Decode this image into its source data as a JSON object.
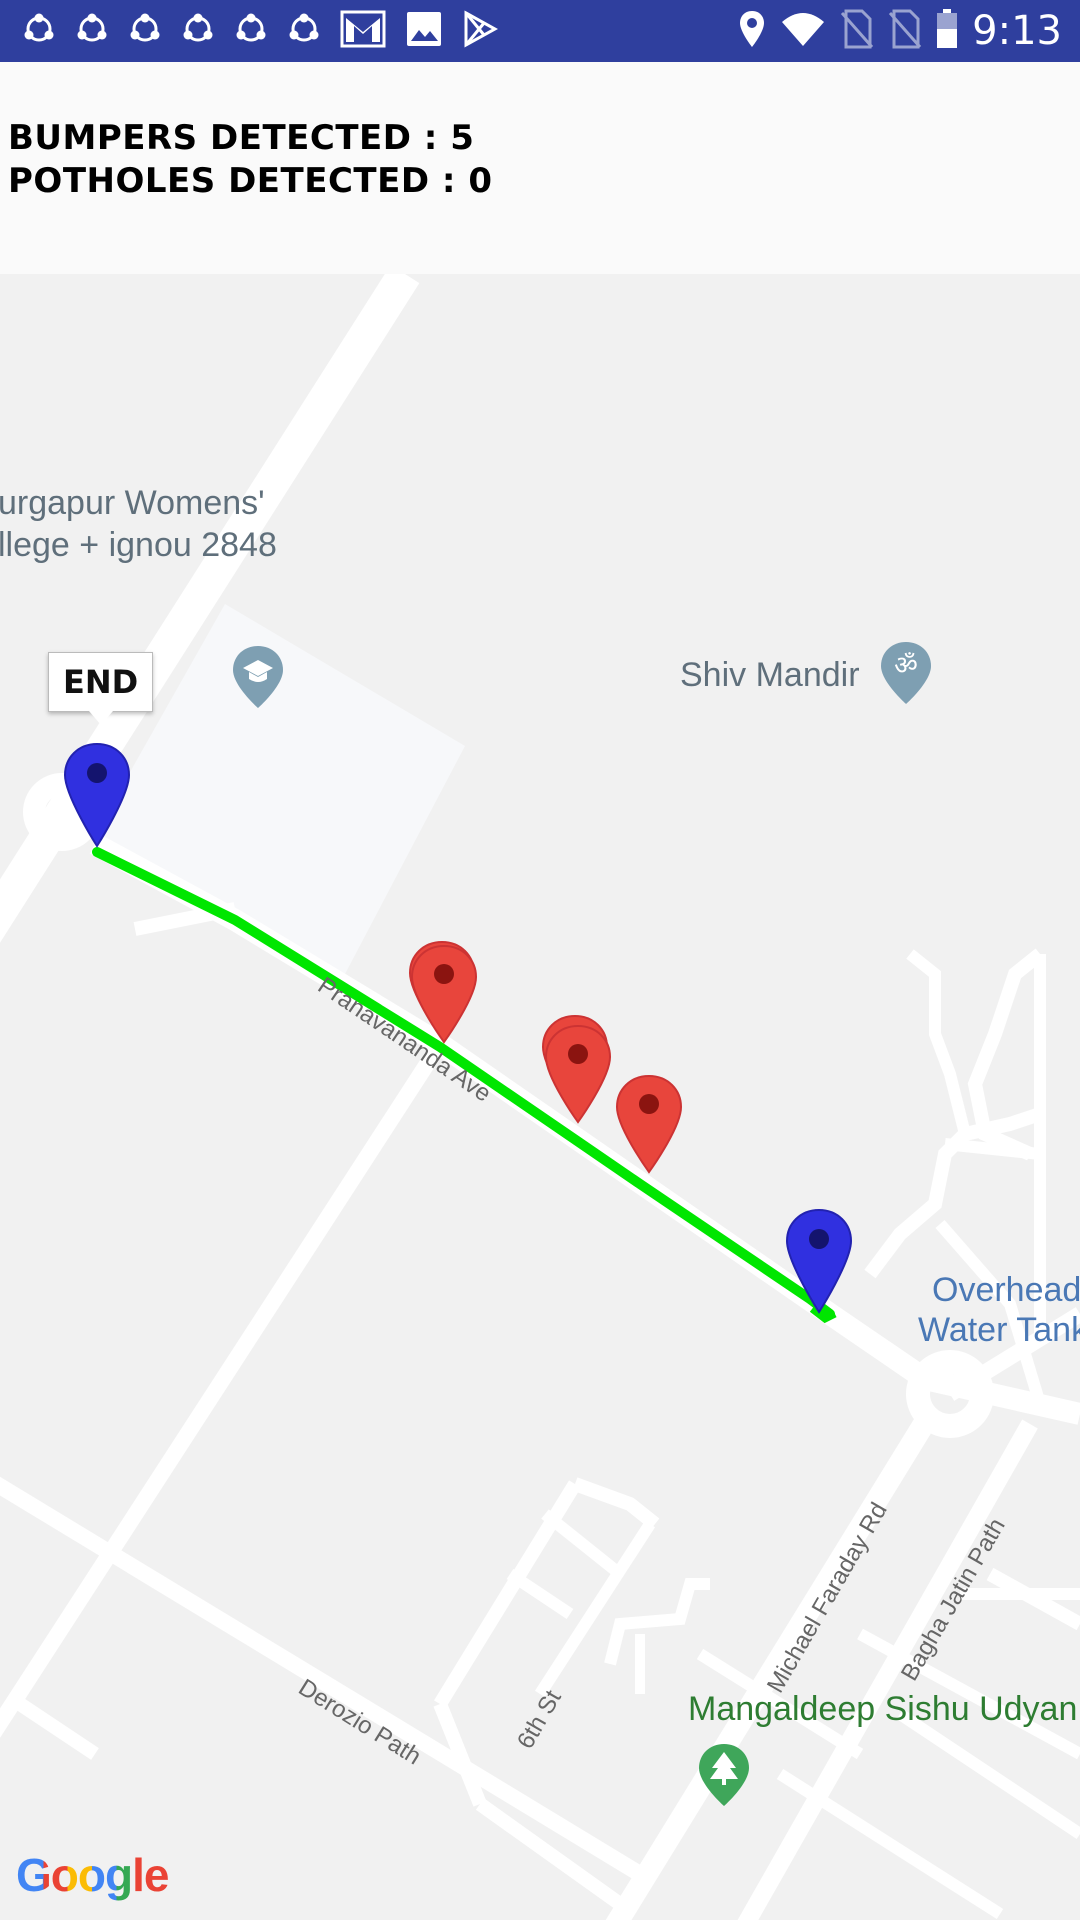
{
  "status_bar": {
    "time": "9:13",
    "notification_icons": [
      "sync-icon",
      "sync-icon",
      "sync-icon",
      "sync-icon",
      "sync-icon",
      "sync-icon",
      "gmail-icon",
      "image-icon",
      "play-store-icon"
    ],
    "system_icons": [
      "location-icon",
      "wifi-icon",
      "no-sim-icon",
      "no-sim-icon",
      "battery-icon"
    ]
  },
  "header": {
    "bumpers": "BUMPERS DETECTED : 5",
    "potholes": "POTHOLES DETECTED : 0"
  },
  "map": {
    "labels": {
      "college_line1": "urgapur Womens'",
      "college_line2": "llege + ignou 2848",
      "temple": "Shiv Mandir",
      "tank_line1": "Overhead",
      "tank_line2": "Water Tank",
      "park": "Mangaldeep Sishu Udyan"
    },
    "streets": {
      "avenue": "Pranavananda Ave",
      "faraday": "Michael Faraday Rd",
      "jatin": "Bagha Jatin Path",
      "sixth": "6th St",
      "derozio": "Derozio Path"
    },
    "end_info": "END",
    "google": "Google",
    "route_color": "#00e600",
    "endpoint_marker_color": "#3030e0",
    "bump_marker_color": "#e8453c"
  }
}
